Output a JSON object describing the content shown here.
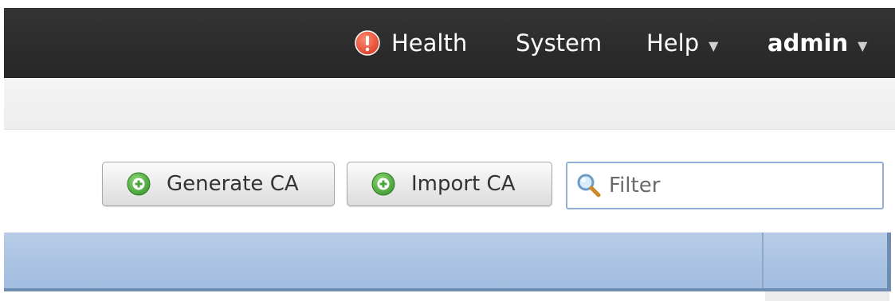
{
  "topbar": {
    "health_label": "Health",
    "system_label": "System",
    "help_label": "Help",
    "user_label": "admin",
    "caret_glyph": "▼"
  },
  "toolbar": {
    "generate_ca_label": "Generate CA",
    "import_ca_label": "Import CA"
  },
  "filter": {
    "placeholder": "Filter",
    "value": ""
  },
  "icons": {
    "health": "alert-circle-icon",
    "add": "plus-circle-icon",
    "search": "magnifier-icon"
  },
  "colors": {
    "navbar": "#2d2d2d",
    "health_alert": "#e8553c",
    "add_green": "#5db84a",
    "table_header": "#a9c2e2",
    "filter_border": "#8fb0d4"
  }
}
